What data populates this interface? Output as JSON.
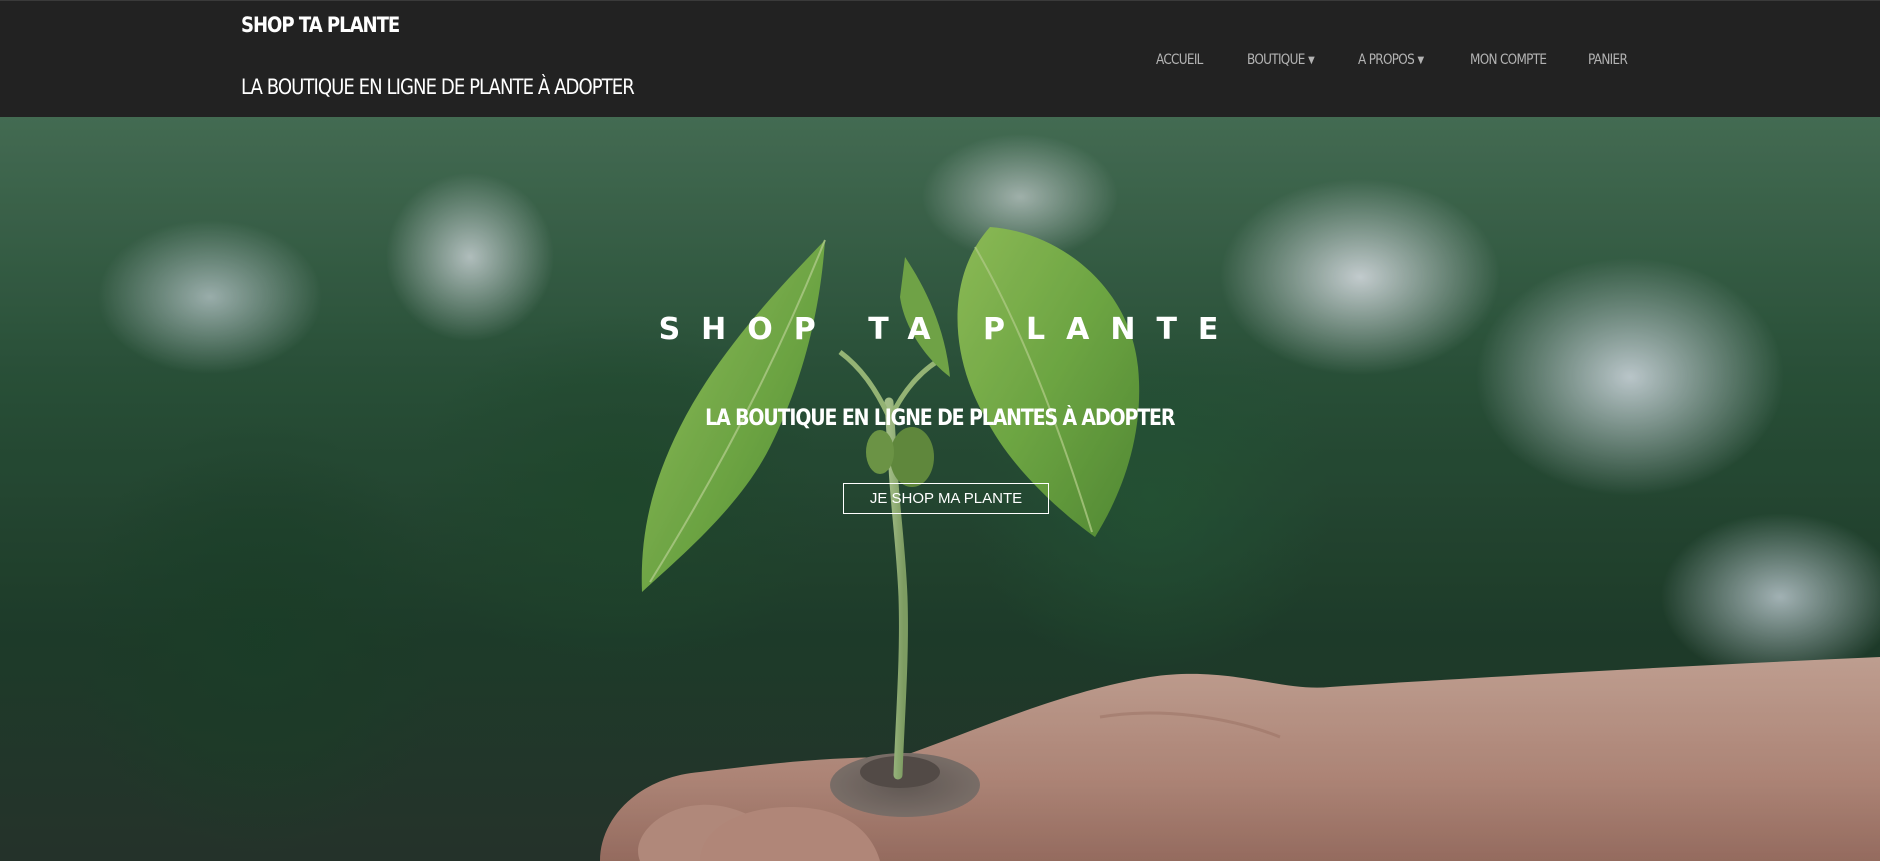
{
  "header": {
    "site_title": "SHOP TA PLANTE",
    "tagline": "LA BOUTIQUE EN LIGNE DE PLANTE À ADOPTER",
    "nav": [
      {
        "label": "ACCUEIL"
      },
      {
        "label": "BOUTIQUE",
        "has_dropdown": true
      },
      {
        "label": "A PROPOS",
        "has_dropdown": true
      },
      {
        "label": "MON COMPTE"
      },
      {
        "label": "PANIER"
      }
    ],
    "background_color": "#222222"
  },
  "hero": {
    "title": "SHOP TA PLANTE",
    "subtitle": "LA BOUTIQUE EN LIGNE DE PLANTES À ADOPTER",
    "cta_label": "JE SHOP MA PLANTE"
  },
  "icons": {
    "dropdown_caret": "caret-down-icon"
  }
}
